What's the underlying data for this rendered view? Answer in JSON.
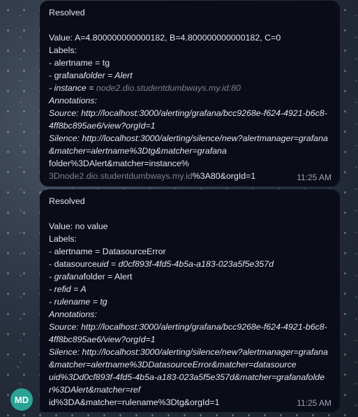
{
  "messages": [
    {
      "status": "Resolved",
      "value": "Value: A=4.800000000000182, B=4.800000000000182, C=0",
      "labels_title": "Labels:",
      "l1": " - alertname = tg",
      "l2a": " - grafana",
      "l2b": "folder = Alert",
      "l3a": " - instance = ",
      "l3b": "node2.dio.studentdumbways.my.id:80",
      "annotations_title": "Annotations:",
      "source": "Source: http://localhost:3000/alerting/grafana/bcc9268e-f624-4921-b6c8-4ff8bc895ae6/view?orgId=1",
      "silence": "Silence: http://localhost:3000/alerting/silence/new?alertmanager=grafana&matcher=alertname%3Dtg&matcher=grafana",
      "silence_end_a": "folder%3DAlert&matcher=instance%",
      "silence_end_b": "3Dnode2.dio.studentdumbways.my.id",
      "silence_end_c": "%3A80&orgId=1",
      "time": "11:25 AM"
    },
    {
      "status": "Resolved",
      "value": "Value: no value",
      "labels_title": "Labels:",
      "l1": " - alertname = DatasourceError",
      "l2a": " - datasource",
      "l2b": "uid = d0cf893f-4fd5-4b5a-a183-023a5f5e357d",
      "l3a": " - grafana",
      "l3b": "folder = Alert",
      "l4": " - refid = A",
      "l5": " - rulename = tg",
      "annotations_title": "Annotations:",
      "source": "Source: http://localhost:3000/alerting/grafana/bcc9268e-f624-4921-b6c8-4ff8bc895ae6/view?orgId=1",
      "silence": "Silence: http://localhost:3000/alerting/silence/new?alertmanager=grafana&matcher=alertname%3DDatasourceError&matcher=datasource",
      "silence_b": "uid%3Dd0cf893f-4fd5-4b5a-a183-023a5f5e357d&matcher=grafana",
      "silence_c": "folder%3DAlert&matcher=ref",
      "silence_d": "id%3DA&matcher=rulename%3Dtg&orgId=1",
      "time": "11:25 AM"
    }
  ],
  "avatar": {
    "initials": "MD",
    "color": "#2aa394"
  }
}
